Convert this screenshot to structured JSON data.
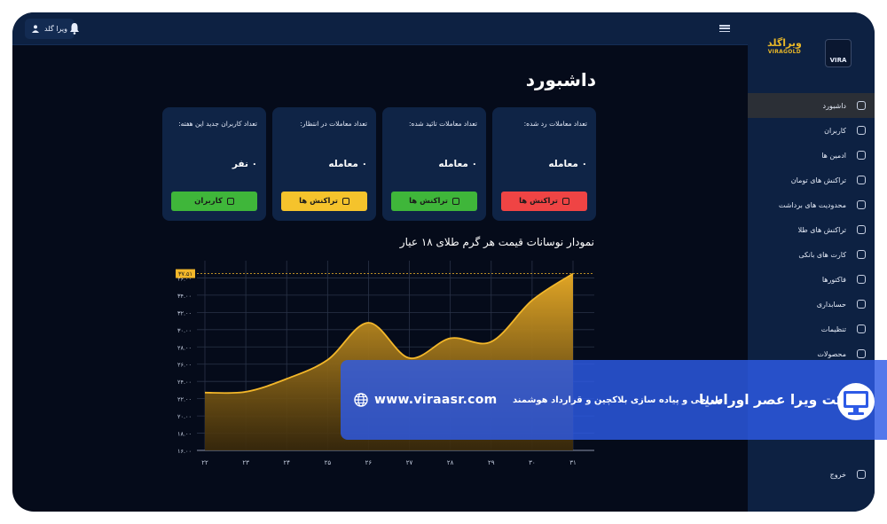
{
  "topbar": {
    "username": "ویرا گلد",
    "user_icon": "user-icon",
    "bell_icon": "bell-icon",
    "menu_icon": "hamburger-icon"
  },
  "brand": {
    "name_fa": "ویراگلد",
    "name_en": "VIRAGOLD",
    "logo_text": "VIRA"
  },
  "sidebar": {
    "items": [
      {
        "label": "داشبورد",
        "icon": "grid-icon",
        "active": true
      },
      {
        "label": "کاربران",
        "icon": "user-icon",
        "active": false
      },
      {
        "label": "ادمین ها",
        "icon": "admin-icon",
        "active": false
      },
      {
        "label": "تراکنش های تومان",
        "icon": "wallet-icon",
        "active": false
      },
      {
        "label": "محدودیت های برداشت",
        "icon": "limit-icon",
        "active": false
      },
      {
        "label": "تراکنش های طلا",
        "icon": "gold-icon",
        "active": false
      },
      {
        "label": "کارت های بانکی",
        "icon": "card-icon",
        "active": false
      },
      {
        "label": "فاکتورها",
        "icon": "invoice-icon",
        "active": false
      },
      {
        "label": "حسابداری",
        "icon": "accounting-icon",
        "active": false
      },
      {
        "label": "تنظیمات",
        "icon": "settings-icon",
        "active": false
      },
      {
        "label": "محصولات",
        "icon": "product-icon",
        "active": false
      }
    ],
    "logout": "خروج"
  },
  "page": {
    "title": "داشبورد"
  },
  "cards": [
    {
      "label": "تعداد کاربران جدید این هفته:",
      "value": "۰ نفر",
      "button": "کاربران",
      "color": "#3fb63a"
    },
    {
      "label": "تعداد معاملات در انتظار:",
      "value": "۰ معامله",
      "button": "تراکنش ها",
      "color": "#f5c32c"
    },
    {
      "label": "تعداد معاملات تائید شده:",
      "value": "۰ معامله",
      "button": "تراکنش ها",
      "color": "#3fb63a"
    },
    {
      "label": "تعداد معاملات رد شده:",
      "value": "۰ معامله",
      "button": "تراکنش ها",
      "color": "#ef4444"
    }
  ],
  "chart_title": "نمودار نوسانات قیمت هر گرم طلای ۱۸ عیار",
  "chart_data": {
    "type": "area",
    "x": [
      "۲۲",
      "۲۳",
      "۲۴",
      "۲۵",
      "۲۶",
      "۲۷",
      "۲۸",
      "۲۹",
      "۳۰",
      "۳۱"
    ],
    "values": [
      22.7,
      22.8,
      24.3,
      26.5,
      30.8,
      26.7,
      29.0,
      28.6,
      33.4,
      36.5
    ],
    "y_ticks": [
      "۱۶.۰۰",
      "۱۸.۰۰",
      "۲۰.۰۰",
      "۲۲.۰۰",
      "۲۴.۰۰",
      "۲۶.۰۰",
      "۲۸.۰۰",
      "۳۰.۰۰",
      "۳۲.۰۰",
      "۳۴.۰۰",
      "۳۶.۰۰"
    ],
    "ylim": [
      16,
      38
    ],
    "highlight_label": "۳۷.۵۱",
    "highlight_value": 36.5,
    "grid": true,
    "line_color": "#f3b72a",
    "fill_color": "#c9901c"
  },
  "banner": {
    "url": "www.viraasr.com",
    "tagline": "طراحی و پیاده سازی بلاکچین و قرارداد هوشمند",
    "company": "شرکت ویرا عصر اوراسیا",
    "globe_icon": "globe-icon",
    "logo_icon": "monitor-logo-icon",
    "bg": "#2d5ae6"
  }
}
